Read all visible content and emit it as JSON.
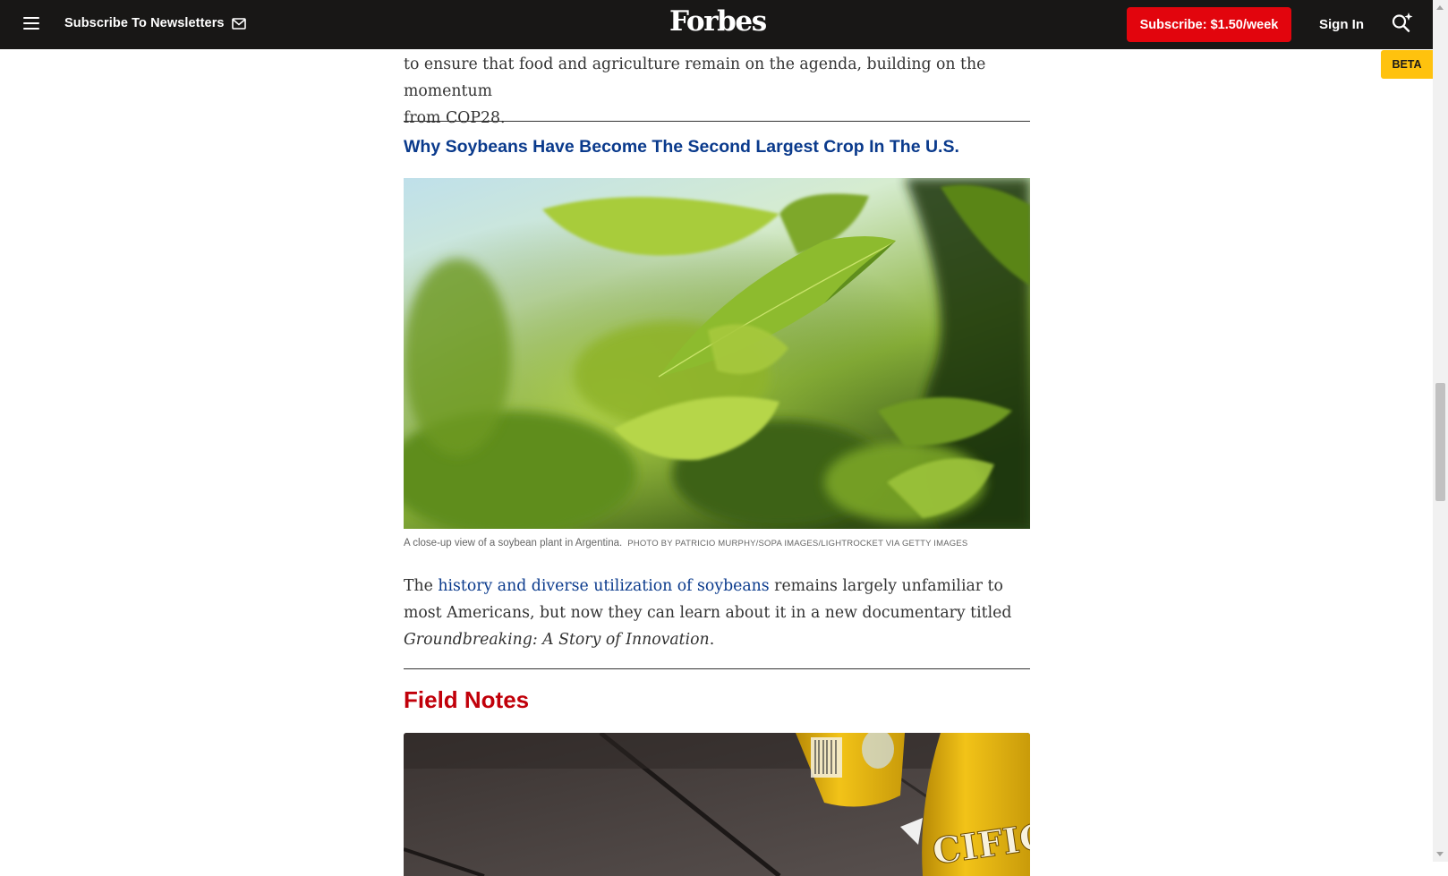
{
  "nav": {
    "newsletter_label": "Subscribe To Newsletters",
    "logo": "Forbes",
    "subscribe_label": "Subscribe: $1.50/week",
    "signin_label": "Sign In",
    "beta_label": "BETA"
  },
  "article": {
    "para1_line1": "to ensure that food and agriculture remain on the agenda, building on the momentum",
    "para1_line2": "from COP28.",
    "related_headline": "Why Soybeans Have Become The Second Largest Crop In The U.S.",
    "caption": "A close-up view of a soybean plant in Argentina.",
    "credit": "PHOTO BY PATRICIO MURPHY/SOPA IMAGES/LIGHTROCKET VIA GETTY IMAGES",
    "para2_start": "The ",
    "para2_link": "history and diverse utilization of soybeans",
    "para2_mid": " remains largely unfamiliar to most Americans, but now they can learn about it in a new documentary titled ",
    "para2_italic": "Groundbreaking: A Story of Innovation",
    "para2_end": ".",
    "section_title": "Field Notes",
    "can_text": "CIFICO"
  },
  "colors": {
    "nav_bg": "#181716",
    "subscribe_red": "#e2050d",
    "link_blue": "#0a3a8c",
    "section_red": "#c1000a",
    "beta_yellow": "#ffc20e"
  },
  "icons": [
    "menu-icon",
    "mail-icon",
    "ai-search-icon"
  ]
}
